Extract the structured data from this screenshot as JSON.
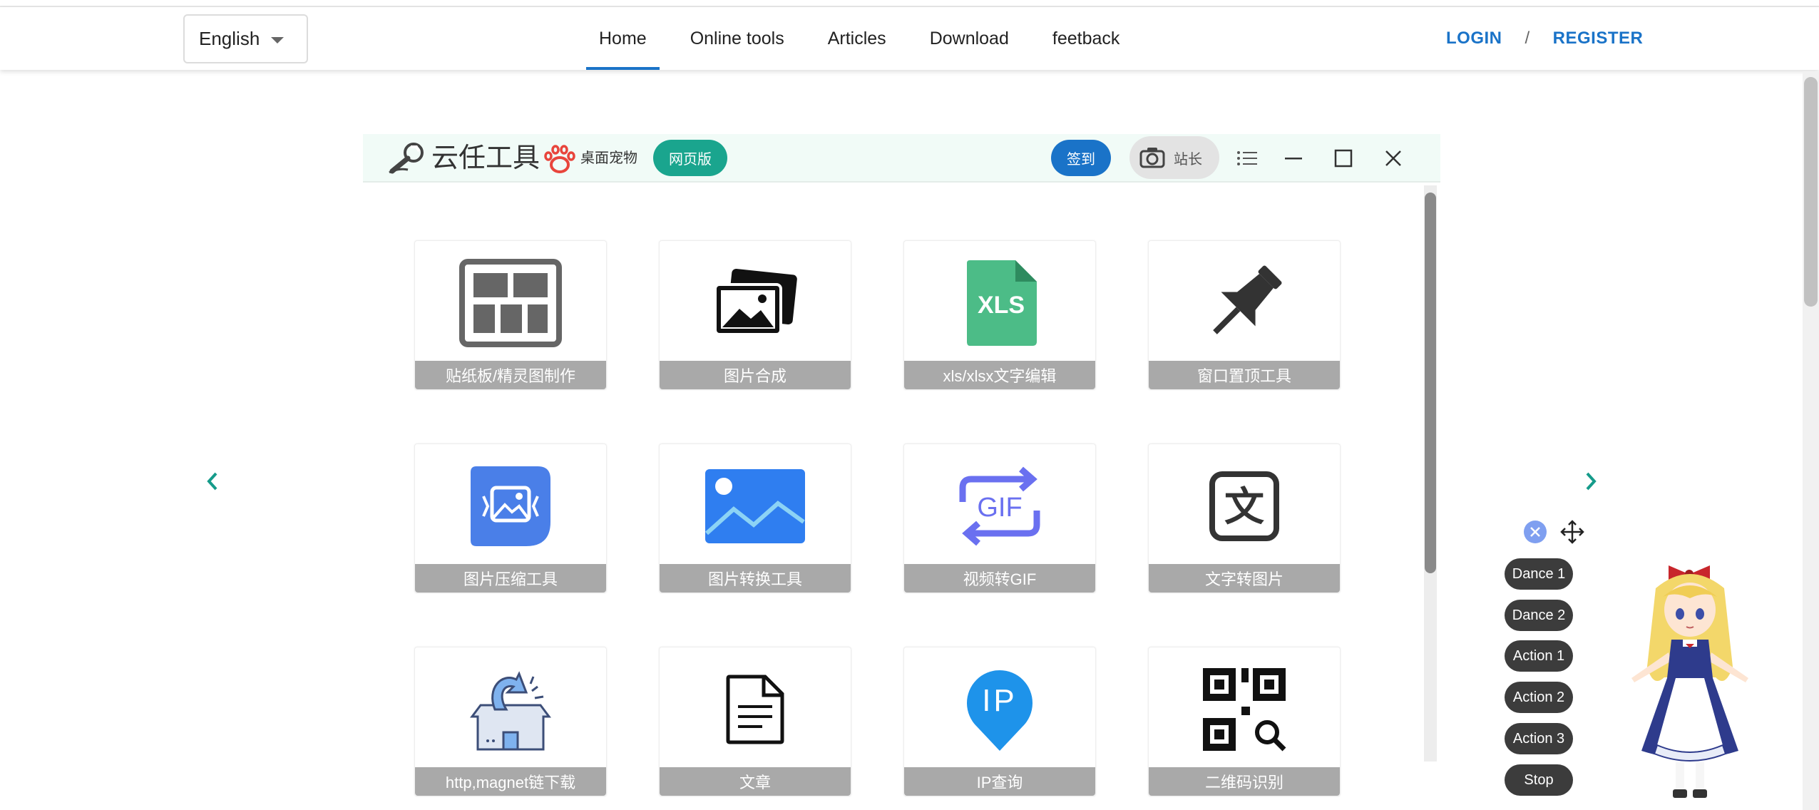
{
  "nav": {
    "language": "English",
    "links": [
      "Home",
      "Online tools",
      "Articles",
      "Download",
      "feetback"
    ],
    "active": "Home",
    "login": "LOGIN",
    "separator": "/",
    "register": "REGISTER"
  },
  "app": {
    "title": "云任工具",
    "pet_label": "桌面宠物",
    "web_button": "网页版",
    "sign_button": "签到",
    "webmaster_label": "站长",
    "tools": [
      {
        "label": "贴纸板/精灵图制作",
        "icon": "grid-layout-icon"
      },
      {
        "label": "图片合成",
        "icon": "image-stack-icon"
      },
      {
        "label": "xls/xlsx文字编辑",
        "icon": "xls-file-icon"
      },
      {
        "label": "窗口置顶工具",
        "icon": "pin-icon"
      },
      {
        "label": "图片压缩工具",
        "icon": "image-compress-icon"
      },
      {
        "label": "图片转换工具",
        "icon": "image-convert-icon"
      },
      {
        "label": "视频转GIF",
        "icon": "gif-convert-icon"
      },
      {
        "label": "文字转图片",
        "icon": "text-to-image-icon"
      },
      {
        "label": "http,magnet链下载",
        "icon": "download-box-icon"
      },
      {
        "label": "文章",
        "icon": "document-icon"
      },
      {
        "label": "IP查询",
        "icon": "ip-location-icon"
      },
      {
        "label": "二维码识别",
        "icon": "qr-scan-icon"
      }
    ],
    "icon_text": {
      "xls": "XLS",
      "gif": "GIF",
      "ip": "IP",
      "wen": "文"
    }
  },
  "pet": {
    "actions": [
      "Dance 1",
      "Dance 2",
      "Action 1",
      "Action 2",
      "Action 3",
      "Stop"
    ]
  },
  "colors": {
    "accent_blue": "#1a73c8",
    "teal": "#1aa58e",
    "tile_label_bg": "#a9a9a9",
    "pet_button_bg": "#3c3c3c"
  }
}
